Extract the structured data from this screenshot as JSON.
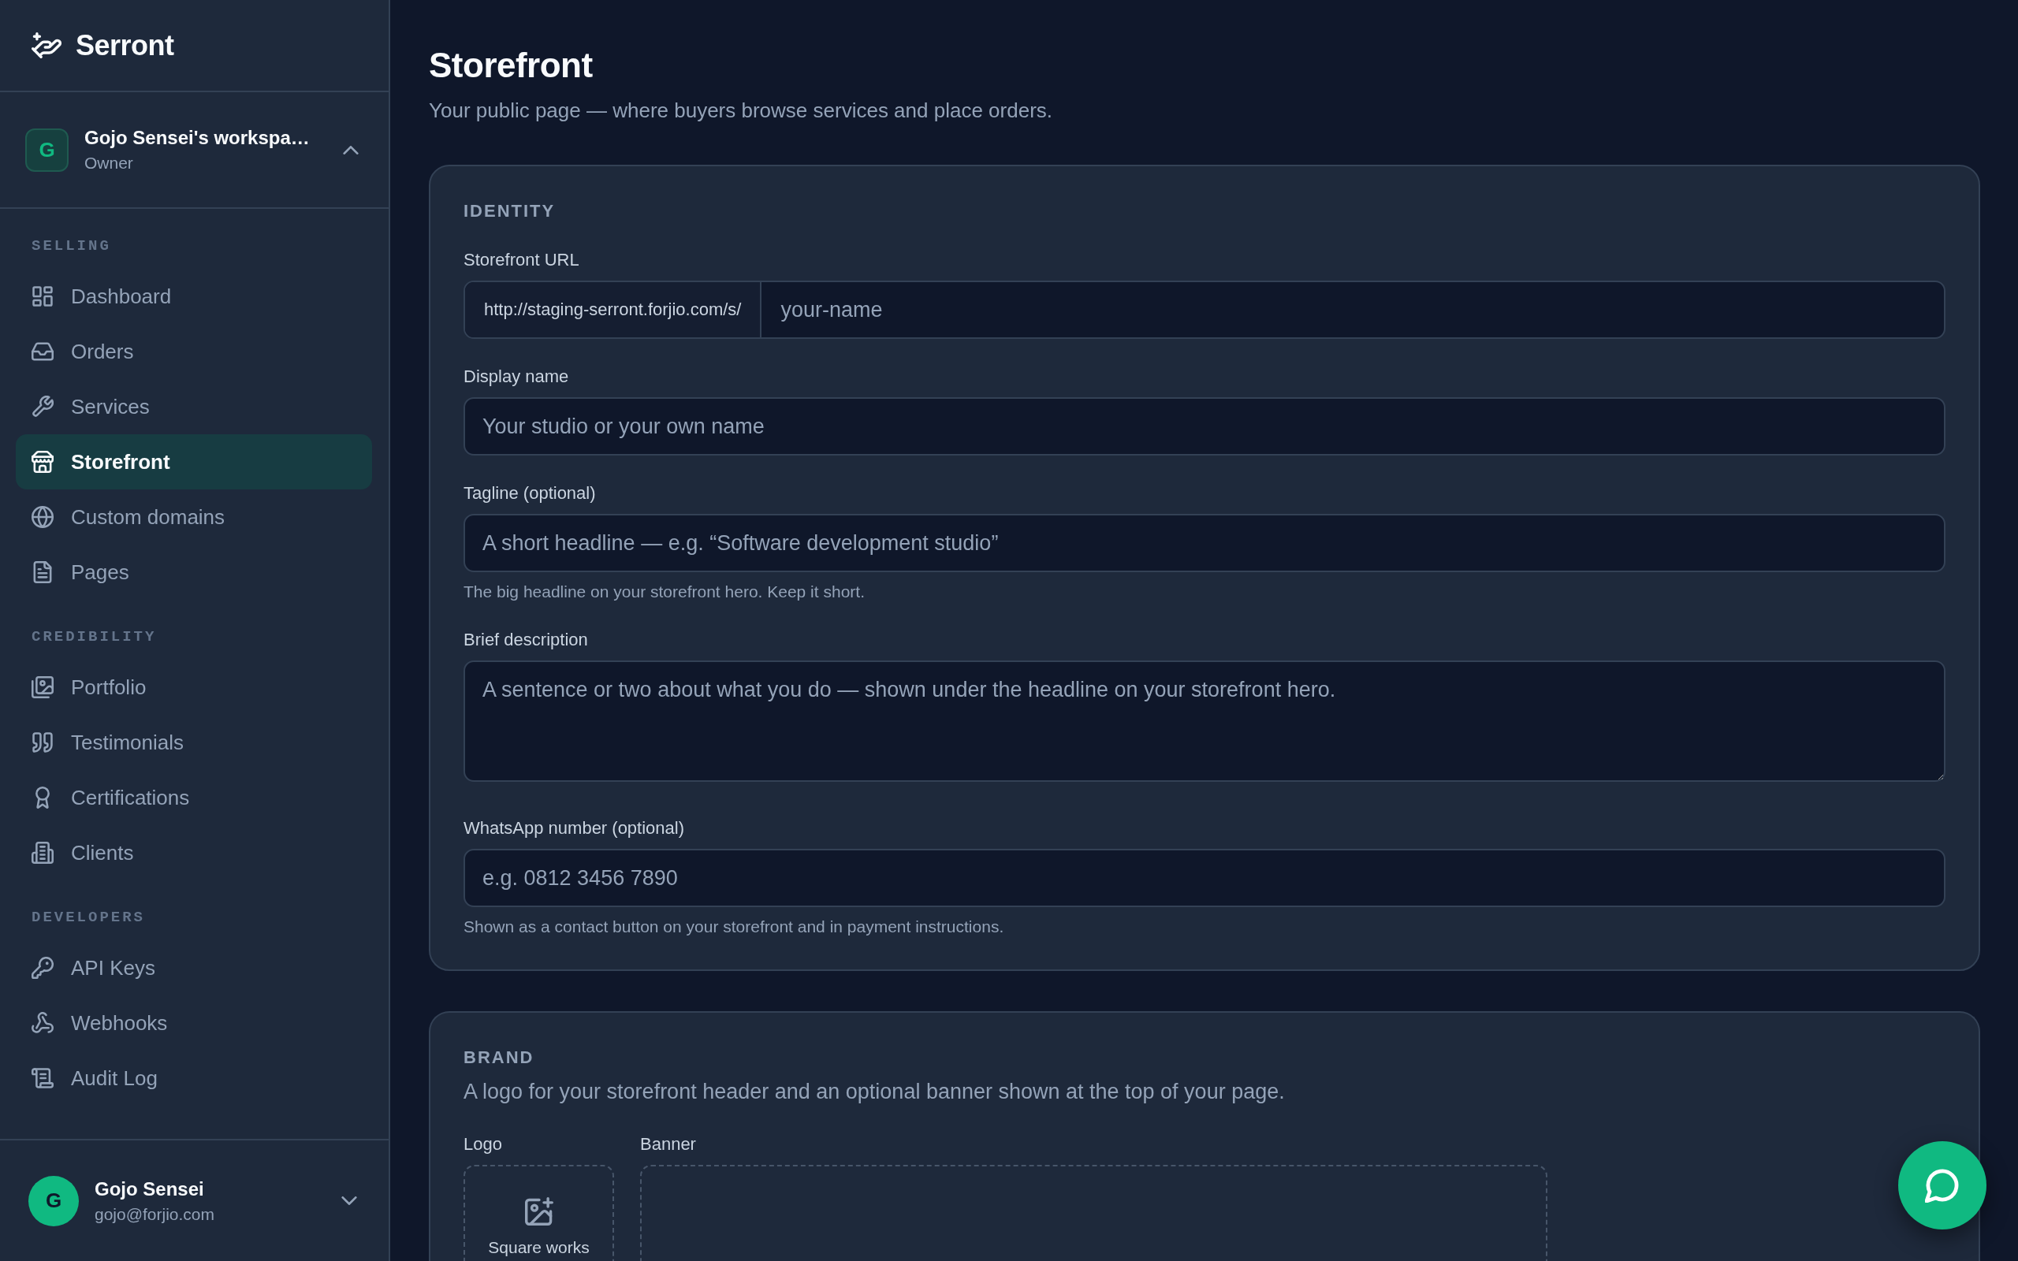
{
  "sidebar": {
    "brand": "Serront",
    "workspace": {
      "initial": "G",
      "name": "Gojo Sensei's workspa…",
      "role": "Owner"
    },
    "sections": [
      {
        "title": "SELLING",
        "items": [
          {
            "label": "Dashboard",
            "selected": false
          },
          {
            "label": "Orders",
            "selected": false
          },
          {
            "label": "Services",
            "selected": false
          },
          {
            "label": "Storefront",
            "selected": true
          },
          {
            "label": "Custom domains",
            "selected": false
          },
          {
            "label": "Pages",
            "selected": false
          }
        ]
      },
      {
        "title": "CREDIBILITY",
        "items": [
          {
            "label": "Portfolio",
            "selected": false
          },
          {
            "label": "Testimonials",
            "selected": false
          },
          {
            "label": "Certifications",
            "selected": false
          },
          {
            "label": "Clients",
            "selected": false
          }
        ]
      },
      {
        "title": "DEVELOPERS",
        "items": [
          {
            "label": "API Keys",
            "selected": false
          },
          {
            "label": "Webhooks",
            "selected": false
          },
          {
            "label": "Audit Log",
            "selected": false
          }
        ]
      }
    ],
    "user": {
      "initial": "G",
      "name": "Gojo Sensei",
      "email": "gojo@forjio.com"
    }
  },
  "page": {
    "title": "Storefront",
    "subtitle": "Your public page — where buyers browse services and place orders."
  },
  "cards": [
    {
      "kind": "form",
      "title": "IDENTITY",
      "fields": [
        {
          "kind": "url",
          "label": "Storefront URL",
          "prefix": "http://staging-serront.forjio.com/s/",
          "placeholder": "your-name"
        },
        {
          "kind": "text",
          "label": "Display name",
          "placeholder": "Your studio or your own name"
        },
        {
          "kind": "text",
          "label": "Tagline (optional)",
          "placeholder": "A short headline — e.g. “Software development studio”",
          "hint": "The big headline on your storefront hero. Keep it short."
        },
        {
          "kind": "textarea",
          "label": "Brief description",
          "placeholder": "A sentence or two about what you do — shown under the headline on your storefront hero."
        },
        {
          "kind": "text",
          "label": "WhatsApp number (optional)",
          "placeholder": "e.g. 0812 3456 7890",
          "hint": "Shown as a contact button on your storefront and in payment instructions."
        }
      ]
    },
    {
      "kind": "uploads",
      "title": "BRAND",
      "description": "A logo for your storefront header and an optional banner shown at the top of your page.",
      "uploads": [
        {
          "kind": "logo",
          "label": "Logo",
          "caption": "Square works"
        },
        {
          "kind": "banner",
          "label": "Banner"
        }
      ]
    }
  ]
}
